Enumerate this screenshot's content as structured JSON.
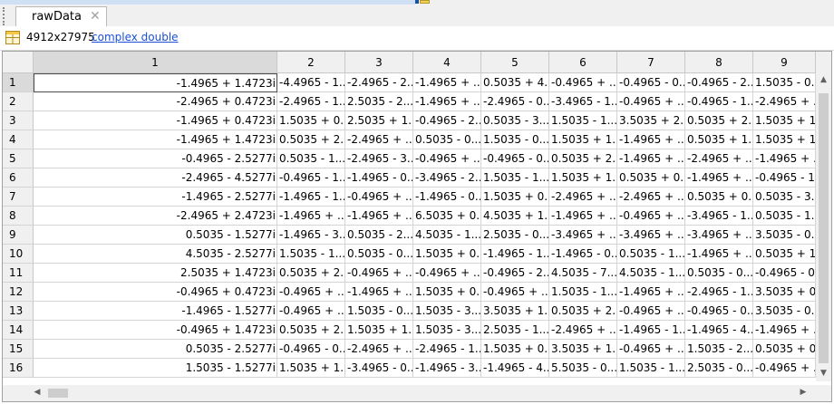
{
  "tab": {
    "title": "rawData",
    "close_glyph": "✕"
  },
  "info": {
    "dimensions": "4912x27975",
    "class_link": "complex double"
  },
  "table": {
    "columns": [
      "1",
      "2",
      "3",
      "4",
      "5",
      "6",
      "7",
      "8",
      "9"
    ],
    "rows": [
      {
        "num": "1",
        "cells": [
          "-1.4965 + 1.4723i",
          "-4.4965 - 1...",
          "-2.4965 - 2...",
          "-1.4965 + ...",
          "0.5035 + 4...",
          "-0.4965 + ...",
          "-0.4965 - 0...",
          "-0.4965 - 2...",
          "1.5035 - 0..."
        ]
      },
      {
        "num": "2",
        "cells": [
          "-2.4965 + 0.4723i",
          "-2.4965 - 1...",
          "2.5035 - 2...",
          "-1.4965 + ...",
          "-2.4965 - 0...",
          "-3.4965 - 1...",
          "-0.4965 + ...",
          "-0.4965 - 1...",
          "-2.4965 + ..."
        ]
      },
      {
        "num": "3",
        "cells": [
          "-1.4965 + 0.4723i",
          "1.5035 + 0...",
          "2.5035 + 1...",
          "-0.4965 - 2...",
          "0.5035 - 3...",
          "1.5035 - 1...",
          "3.5035 + 2...",
          "0.5035 + 2...",
          "1.5035 + 1..."
        ]
      },
      {
        "num": "4",
        "cells": [
          "-1.4965 + 1.4723i",
          "0.5035 + 2...",
          "-2.4965 + ...",
          "0.5035 - 0...",
          "1.5035 - 0...",
          "1.5035 + 1...",
          "-1.4965 + ...",
          "0.5035 + 1...",
          "1.5035 + 1..."
        ]
      },
      {
        "num": "5",
        "cells": [
          "-0.4965 - 2.5277i",
          "0.5035 - 1...",
          "-2.4965 - 3...",
          "-0.4965 + ...",
          "-0.4965 - 0...",
          "0.5035 + 2...",
          "-1.4965 + ...",
          "-2.4965 + ...",
          "-1.4965 + ..."
        ]
      },
      {
        "num": "6",
        "cells": [
          "-2.4965 - 4.5277i",
          "-0.4965 - 1...",
          "-1.4965 - 0...",
          "-3.4965 - 2...",
          "1.5035 - 1...",
          "1.5035 + 1...",
          "0.5035 + 0...",
          "-1.4965 + ...",
          "-0.4965 - 1..."
        ]
      },
      {
        "num": "7",
        "cells": [
          "-1.4965 - 2.5277i",
          "-1.4965 - 1...",
          "-0.4965 + ...",
          "-1.4965 - 0...",
          "1.5035 + 0...",
          "-2.4965 + ...",
          "-2.4965 + ...",
          "0.5035 + 0...",
          "0.5035 - 3..."
        ]
      },
      {
        "num": "8",
        "cells": [
          "-2.4965 + 2.4723i",
          "-1.4965 + ...",
          "-1.4965 + ...",
          "6.5035 + 0...",
          "4.5035 + 1...",
          "-1.4965 + ...",
          "-0.4965 + ...",
          "-3.4965 - 1...",
          "0.5035 - 1..."
        ]
      },
      {
        "num": "9",
        "cells": [
          "0.5035 - 1.5277i",
          "-1.4965 - 3...",
          "0.5035 - 2...",
          "4.5035 - 1...",
          "2.5035 - 0...",
          "-3.4965 + ...",
          "-3.4965 + ...",
          "-3.4965 + ...",
          "3.5035 - 0..."
        ]
      },
      {
        "num": "10",
        "cells": [
          "4.5035 - 2.5277i",
          "1.5035 - 1...",
          "0.5035 - 0...",
          "1.5035 + 0...",
          "-1.4965 - 1...",
          "-1.4965 - 0...",
          "0.5035 - 1...",
          "-1.4965 + ...",
          "0.5035 + 1..."
        ]
      },
      {
        "num": "11",
        "cells": [
          "2.5035 + 1.4723i",
          "0.5035 + 2...",
          "-0.4965 + ...",
          "-0.4965 + ...",
          "-0.4965 - 2...",
          "4.5035 - 7...",
          "4.5035 - 1...",
          "0.5035 - 0...",
          "-0.4965 - 0..."
        ]
      },
      {
        "num": "12",
        "cells": [
          "-0.4965 + 0.4723i",
          "-0.4965 + ...",
          "-1.4965 + ...",
          "1.5035 + 0...",
          "-0.4965 + ...",
          "1.5035 - 1...",
          "-1.4965 + ...",
          "-2.4965 - 1...",
          "3.5035 + 0..."
        ]
      },
      {
        "num": "13",
        "cells": [
          "-1.4965 - 1.5277i",
          "-0.4965 + ...",
          "1.5035 - 0...",
          "1.5035 - 3...",
          "3.5035 + 1...",
          "0.5035 + 2...",
          "-0.4965 + ...",
          "-0.4965 - 0...",
          "3.5035 - 0..."
        ]
      },
      {
        "num": "14",
        "cells": [
          "-0.4965 + 1.4723i",
          "0.5035 + 2...",
          "1.5035 + 1...",
          "1.5035 - 3...",
          "2.5035 - 1...",
          "-2.4965 + ...",
          "-1.4965 - 1...",
          "-1.4965 - 4...",
          "-1.4965 + ..."
        ]
      },
      {
        "num": "15",
        "cells": [
          "0.5035 - 2.5277i",
          "-0.4965 - 0...",
          "-2.4965 + ...",
          "-2.4965 - 1...",
          "1.5035 + 0...",
          "3.5035 + 1...",
          "-0.4965 + ...",
          "1.5035 - 2...",
          "0.5035 + 0..."
        ]
      },
      {
        "num": "16",
        "cells": [
          "1.5035 - 1.5277i",
          "1.5035 + 1...",
          "-3.4965 - 0...",
          "-1.4965 - 3...",
          "-1.4965 - 4...",
          "5.5035 - 0...",
          "1.5035 - 1...",
          "2.5035 - 0...",
          "-0.4965 + ..."
        ]
      }
    ]
  },
  "icons": {
    "matrix": "matrix-grid-icon",
    "scroll_up": "chevron-up-icon",
    "scroll_down": "chevron-down-icon",
    "scroll_left": "chevron-left-icon",
    "scroll_right": "chevron-right-icon"
  },
  "colors": {
    "link": "#1a4fd6",
    "header_bg": "#f0f0f0",
    "selected_header_bg": "#dadada"
  }
}
